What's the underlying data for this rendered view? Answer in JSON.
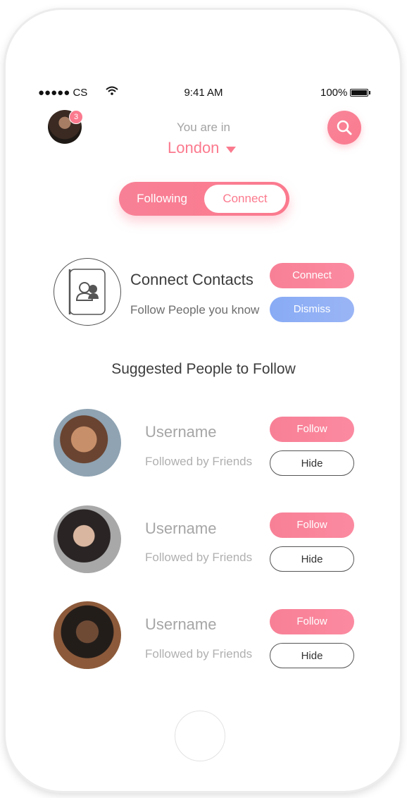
{
  "status_bar": {
    "carrier": "●●●●● CS",
    "time": "9:41 AM",
    "battery": "100%"
  },
  "header": {
    "notification_count": "3",
    "location_prompt": "You are in",
    "location": "London"
  },
  "tabs": {
    "following": "Following",
    "connect": "Connect",
    "active": "connect"
  },
  "connect_contacts": {
    "title": "Connect Contacts",
    "subtitle": "Follow People you know",
    "connect_label": "Connect",
    "dismiss_label": "Dismiss"
  },
  "suggested": {
    "title": "Suggested People to Follow",
    "people": [
      {
        "username": "Username",
        "followed_by": "Followed by Friends",
        "follow_label": "Follow",
        "hide_label": "Hide"
      },
      {
        "username": "Username",
        "followed_by": "Followed by Friends",
        "follow_label": "Follow",
        "hide_label": "Hide"
      },
      {
        "username": "Username",
        "followed_by": "Followed by Friends",
        "follow_label": "Follow",
        "hide_label": "Hide"
      }
    ]
  },
  "colors": {
    "accent": "#fb7a8e",
    "secondary": "#88abf5"
  }
}
